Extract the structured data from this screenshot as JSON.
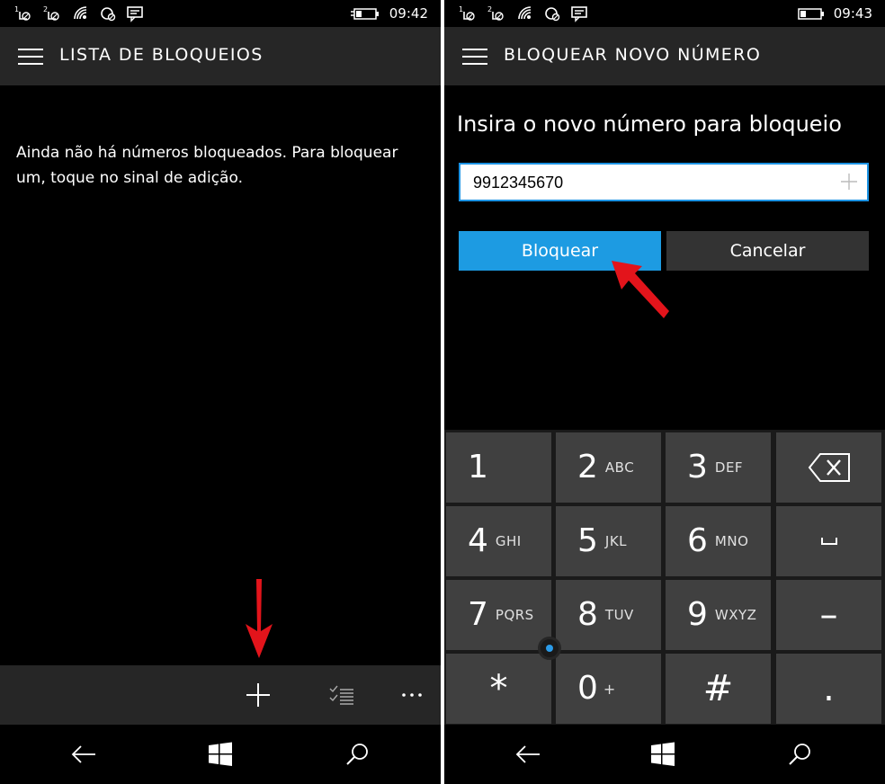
{
  "left": {
    "status": {
      "time": "09:42"
    },
    "title": "LISTA DE BLOQUEIOS",
    "empty_message": "Ainda não há números bloqueados. Para bloquear um, toque no sinal de adição.",
    "appbar": {
      "buttons": [
        "add-icon",
        "select-icon",
        "more-icon"
      ]
    }
  },
  "right": {
    "status": {
      "time": "09:43"
    },
    "title": "BLOQUEAR NOVO NÚMERO",
    "prompt": "Insira o novo número para bloqueio",
    "number_input": {
      "value": "9912345670"
    },
    "block_label": "Bloquear",
    "cancel_label": "Cancelar",
    "keypad": {
      "rows": [
        [
          {
            "digit": "1",
            "letters": ""
          },
          {
            "digit": "2",
            "letters": "ABC"
          },
          {
            "digit": "3",
            "letters": "DEF"
          },
          {
            "icon": "backspace-icon"
          }
        ],
        [
          {
            "digit": "4",
            "letters": "GHI"
          },
          {
            "digit": "5",
            "letters": "JKL"
          },
          {
            "digit": "6",
            "letters": "MNO"
          },
          {
            "icon": "space-icon"
          }
        ],
        [
          {
            "digit": "7",
            "letters": "PQRS"
          },
          {
            "digit": "8",
            "letters": "TUV"
          },
          {
            "digit": "9",
            "letters": "WXYZ"
          },
          {
            "symbol": "–"
          }
        ],
        [
          {
            "symbol": "*"
          },
          {
            "digit": "0",
            "letters": "+"
          },
          {
            "symbol": "#"
          },
          {
            "symbol": "."
          }
        ]
      ]
    }
  },
  "colors": {
    "accent": "#1d9be2",
    "bar": "#262626",
    "key": "#404040",
    "annotation_arrow": "#e3141b"
  }
}
